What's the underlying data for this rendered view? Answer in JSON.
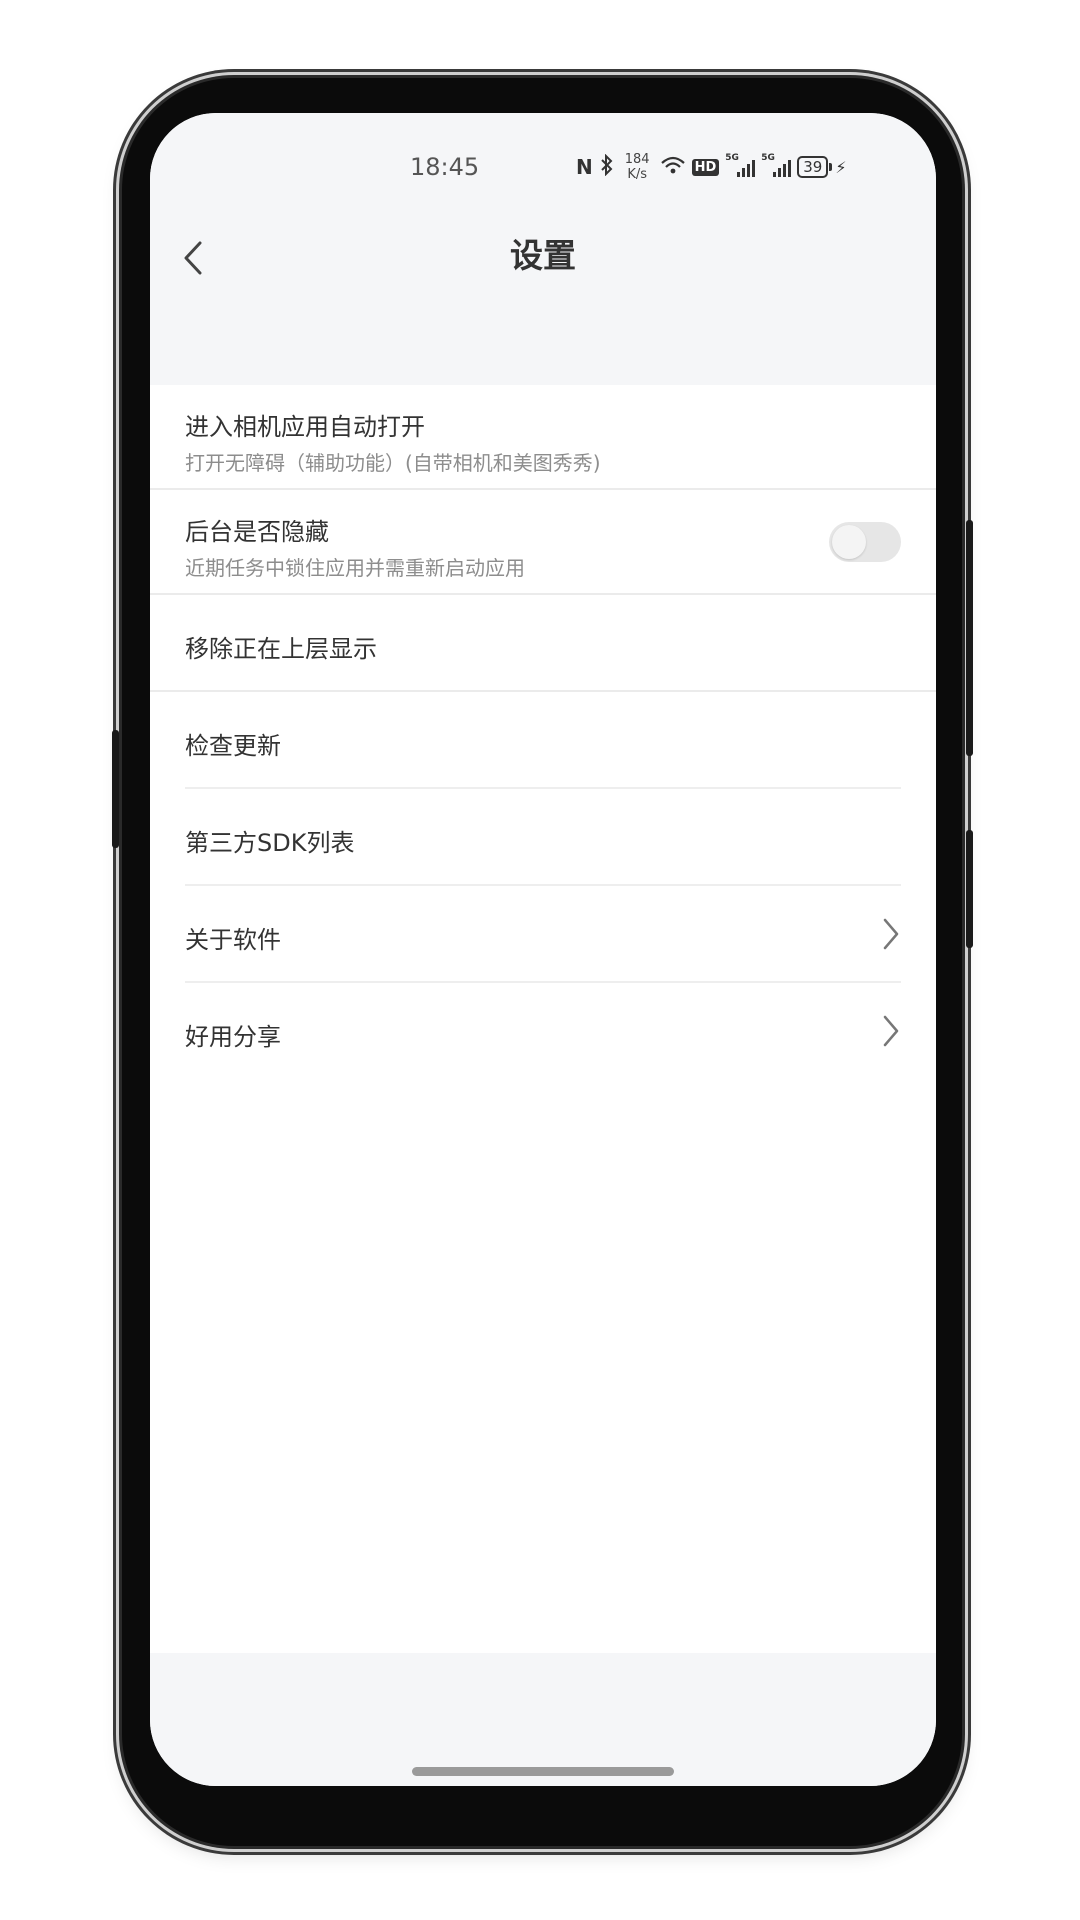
{
  "status_bar": {
    "time": "18:45",
    "nfc": "N",
    "speed_value": "184",
    "speed_unit": "K/s",
    "hd": "HD",
    "sim1_tag": "5G",
    "sim2_tag": "5G",
    "battery": "39"
  },
  "header": {
    "title": "设置",
    "back_icon": "chevron-left-icon"
  },
  "settings": {
    "items": [
      {
        "label": "进入相机应用自动打开",
        "sub": "打开无障碍（辅助功能）(自带相机和美图秀秀)"
      },
      {
        "label": "后台是否隐藏",
        "sub": "近期任务中锁住应用并需重新启动应用",
        "toggle": false
      },
      {
        "label": "移除正在上层显示"
      },
      {
        "label": "检查更新"
      },
      {
        "label": "第三方SDK列表"
      },
      {
        "label": "关于软件",
        "chevron": true
      },
      {
        "label": "好用分享",
        "chevron": true
      }
    ]
  },
  "colors": {
    "header_bg": "#f5f6f8",
    "text_primary": "#333333",
    "text_secondary": "#8d8d8d",
    "divider": "#ebebeb",
    "toggle_off": "#e6e6e6"
  }
}
